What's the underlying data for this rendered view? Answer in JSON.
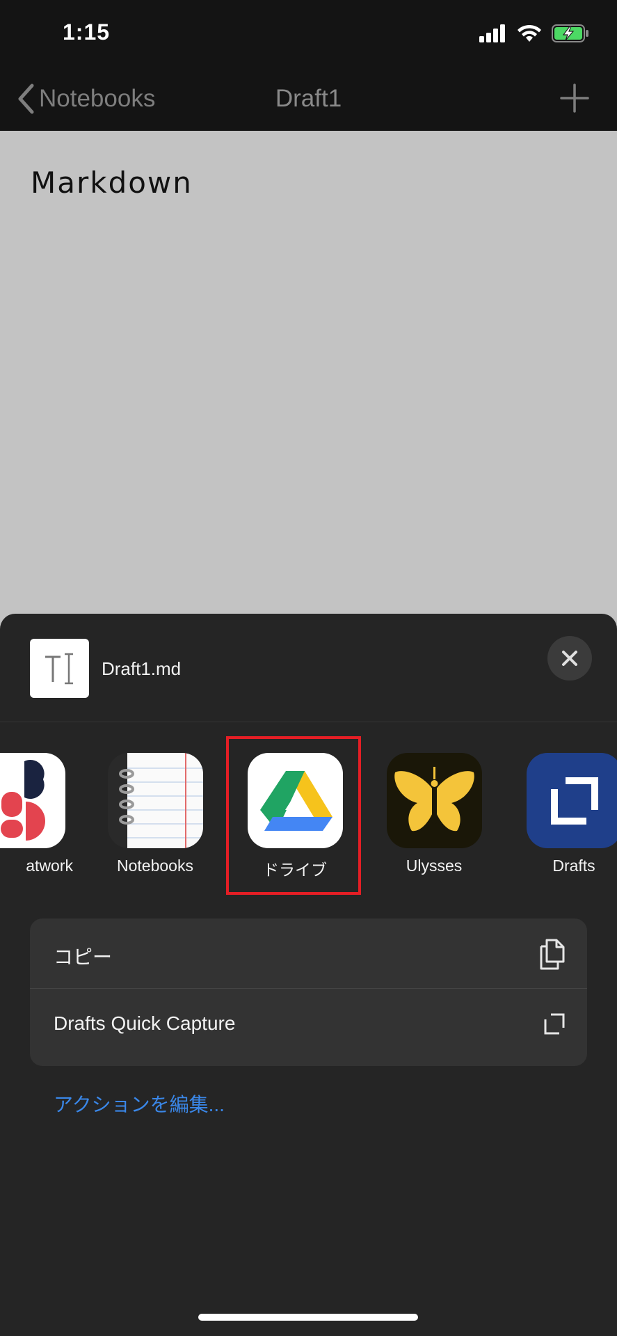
{
  "status": {
    "time": "1:15"
  },
  "nav": {
    "back_label": "Notebooks",
    "title": "Draft1"
  },
  "document": {
    "text": "Markdown"
  },
  "share": {
    "file_name": "Draft1.md",
    "apps": [
      {
        "label": "atwork",
        "icon": "atwork-app-icon"
      },
      {
        "label": "Notebooks",
        "icon": "notebooks-app-icon"
      },
      {
        "label": "ドライブ",
        "icon": "google-drive-icon"
      },
      {
        "label": "Ulysses",
        "icon": "ulysses-butterfly-icon"
      },
      {
        "label": "Drafts",
        "icon": "drafts-app-icon"
      }
    ],
    "actions": [
      {
        "label": "コピー",
        "icon": "copy-icon"
      },
      {
        "label": "Drafts Quick Capture",
        "icon": "drafts-capture-icon"
      }
    ],
    "edit_actions": "アクションを編集..."
  },
  "colors": {
    "highlight": "#e41e25",
    "link": "#3a87e8"
  }
}
